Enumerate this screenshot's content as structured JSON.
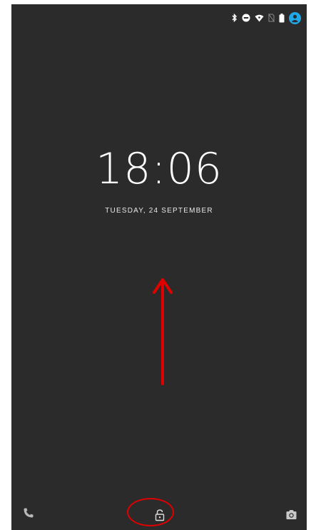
{
  "lockscreen": {
    "time": "18:06",
    "date": "TUESDAY, 24 SEPTEMBER"
  },
  "status_bar": {
    "icons": [
      "bluetooth-icon",
      "do-not-disturb-icon",
      "wifi-icon",
      "no-sim-icon",
      "battery-icon",
      "account-icon"
    ],
    "account_color": "#1fa9e8"
  },
  "shortcuts": {
    "left": "phone-icon",
    "center": "unlock-icon",
    "right": "camera-icon"
  },
  "annotations": {
    "arrow_color": "#e00000",
    "ring_color": "#e00000"
  }
}
